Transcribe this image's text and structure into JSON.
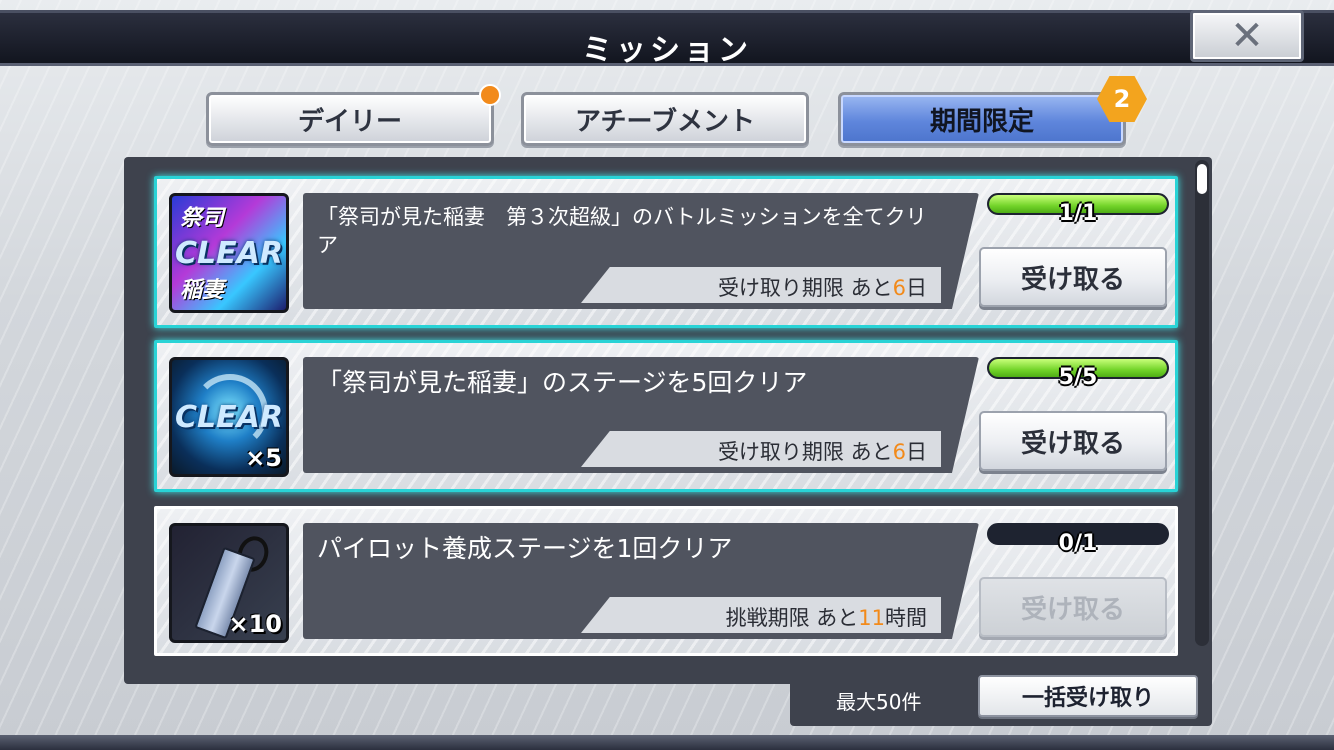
{
  "header": {
    "title": "ミッション",
    "close_glyph": "✕"
  },
  "tabs": [
    {
      "label": "デイリー",
      "active": false,
      "badge": "dot"
    },
    {
      "label": "アチーブメント",
      "active": false
    },
    {
      "label": "期間限定",
      "active": true,
      "badge_count": "2"
    }
  ],
  "missions": [
    {
      "icon": "clear-emblem-icon",
      "icon_text": "CLEAR",
      "icon_deco_top": "祭司",
      "icon_deco_bottom": "稲妻",
      "icon_qty": "",
      "description": "「祭司が見た稲妻　第３次超級」のバトルミッションを全てクリア",
      "deadline_prefix": "受け取り期限 あと",
      "deadline_num": "6",
      "deadline_unit": "日",
      "progress": "1/1",
      "progress_fraction": 1.0,
      "claim_label": "受け取る",
      "claimable": true
    },
    {
      "icon": "clear-orb-icon",
      "icon_text": "CLEAR",
      "icon_qty": "×5",
      "description": "「祭司が見た稲妻」のステージを5回クリア",
      "deadline_prefix": "受け取り期限 あと",
      "deadline_num": "6",
      "deadline_unit": "日",
      "progress": "5/5",
      "progress_fraction": 1.0,
      "claim_label": "受け取る",
      "claimable": true
    },
    {
      "icon": "pilot-tag-icon",
      "icon_qty": "×10",
      "description": "パイロット養成ステージを1回クリア",
      "deadline_prefix": "挑戦期限 あと",
      "deadline_num": "11",
      "deadline_unit": "時間",
      "progress": "0/1",
      "progress_fraction": 0.0,
      "claim_label": "受け取る",
      "claimable": false
    }
  ],
  "footer": {
    "max_label": "最大50件",
    "bulk_claim_label": "一括受け取り"
  },
  "colors": {
    "accent_orange": "#f28a1a",
    "done_border": "#29d3d6",
    "progress_green": "#73d42a",
    "tab_active": "#5f86dc"
  }
}
